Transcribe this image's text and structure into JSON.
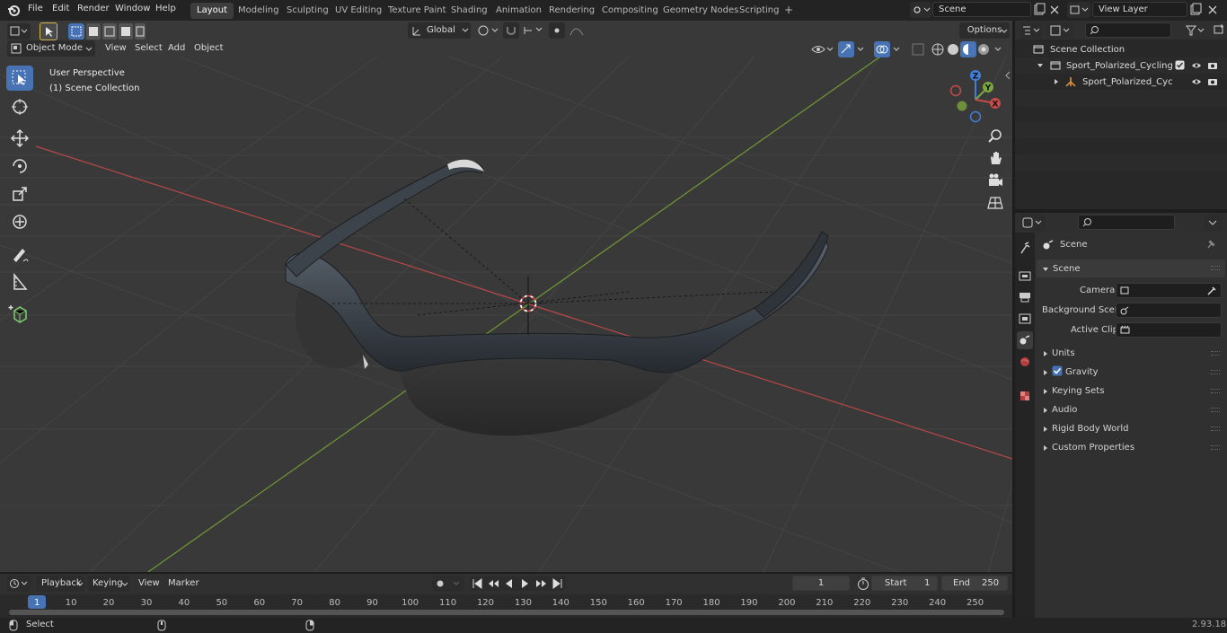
{
  "menu": {
    "file": "File",
    "edit": "Edit",
    "render": "Render",
    "window": "Window",
    "help": "Help"
  },
  "workspaces": [
    {
      "label": "Layout",
      "active": true
    },
    {
      "label": "Modeling",
      "active": false
    },
    {
      "label": "Sculpting",
      "active": false
    },
    {
      "label": "UV Editing",
      "active": false
    },
    {
      "label": "Texture Paint",
      "active": false
    },
    {
      "label": "Shading",
      "active": false
    },
    {
      "label": "Animation",
      "active": false
    },
    {
      "label": "Rendering",
      "active": false
    },
    {
      "label": "Compositing",
      "active": false
    },
    {
      "label": "Geometry Nodes",
      "active": false
    },
    {
      "label": "Scripting",
      "active": false
    }
  ],
  "add_workspace": "+",
  "scene_field": "Scene",
  "view_layer_field": "View Layer",
  "viewport": {
    "mode": "Object Mode",
    "menu_view": "View",
    "menu_select": "Select",
    "menu_add": "Add",
    "menu_object": "Object",
    "transform_orientation": "Global",
    "options": "Options",
    "overlay_title": "User Perspective",
    "overlay_collection": "(1) Scene Collection",
    "gizmo": {
      "z": "Z",
      "y": "Y",
      "x": "X"
    }
  },
  "outliner": {
    "search_placeholder": "",
    "rows": [
      {
        "label": "Scene Collection"
      },
      {
        "label": "Sport_Polarized_Cycling_Sung"
      },
      {
        "label": "Sport_Polarized_Cycling_"
      }
    ]
  },
  "properties": {
    "breadcrumb": "Scene",
    "section_scene": "Scene",
    "camera_label": "Camera",
    "background_scene_label": "Background Scene",
    "active_clip_label": "Active Clip",
    "panels": [
      {
        "label": "Units",
        "checkbox": false
      },
      {
        "label": "Gravity",
        "checkbox": true
      },
      {
        "label": "Keying Sets",
        "checkbox": false
      },
      {
        "label": "Audio",
        "checkbox": false
      },
      {
        "label": "Rigid Body World",
        "checkbox": false
      },
      {
        "label": "Custom Properties",
        "checkbox": false
      }
    ]
  },
  "timeline": {
    "playback": "Playback",
    "keying": "Keying",
    "view": "View",
    "marker": "Marker",
    "current_frame": "1",
    "start_label": "Start",
    "start_value": "1",
    "end_label": "End",
    "end_value": "250",
    "ticks": [
      "1",
      "10",
      "20",
      "30",
      "40",
      "50",
      "60",
      "70",
      "80",
      "90",
      "100",
      "110",
      "120",
      "130",
      "140",
      "150",
      "160",
      "170",
      "180",
      "190",
      "200",
      "210",
      "220",
      "230",
      "240",
      "250"
    ]
  },
  "status": {
    "select": "Select",
    "version": "2.93.18"
  },
  "colors": {
    "accent": "#4772b3",
    "x_axis": "#c64b4b",
    "y_axis": "#7aa83c",
    "z_axis": "#3f7fd8"
  }
}
